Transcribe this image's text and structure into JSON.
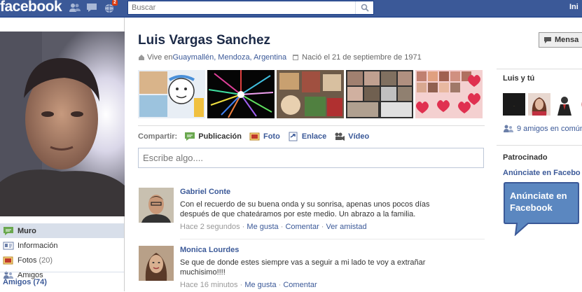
{
  "header": {
    "logo": "facebook",
    "notif_count": "2",
    "search_placeholder": "Buscar",
    "top_link": "Ini"
  },
  "profile": {
    "name": "Luis Vargas Sanchez",
    "lives_prefix": "Vive en ",
    "lives_place": "Guaymallén, Mendoza, Argentina",
    "born": "Nació el 21 de septiembre de 1971"
  },
  "nav": {
    "items": [
      {
        "label": "Muro",
        "icon": "wall-icon"
      },
      {
        "label": "Información",
        "icon": "info-icon"
      },
      {
        "label": "Fotos",
        "count": "(20)",
        "icon": "photos-icon"
      },
      {
        "label": "Amigos",
        "icon": "friends-icon"
      }
    ],
    "friends_header": "Amigos (74)"
  },
  "share": {
    "label": "Compartir:",
    "items": [
      "Publicación",
      "Foto",
      "Enlace",
      "Vídeo"
    ],
    "compose_placeholder": "Escribe algo...."
  },
  "stories": [
    {
      "actor": "Gabriel Conte",
      "message": "Con el recuerdo de su buena onda y su sonrisa, apenas unos pocos días después de que chateáramos por este medio. Un abrazo a la familia.",
      "time": "Hace 2 segundos",
      "actions": [
        "Me gusta",
        "Comentar",
        "Ver amistad"
      ]
    },
    {
      "actor": "Monica Lourdes",
      "message": "Se que de donde estes siempre vas a seguir a mi lado te voy a extrañar muchisimo!!!!",
      "time": "Hace 16 minutos",
      "actions": [
        "Me gusta",
        "Comentar"
      ]
    }
  ],
  "right": {
    "message_button": "Mensa",
    "mutual_header": "Luis y tú",
    "mutual_link": "9 amigos en común",
    "sponsored_header": "Patrocinado",
    "ad_link": "Anúnciate en Facebo",
    "ad_bubble": "Anúnciate en Facebook"
  },
  "colors": {
    "brand": "#3b5998",
    "nav_active": "#d8dfea",
    "link": "#3b5998"
  }
}
